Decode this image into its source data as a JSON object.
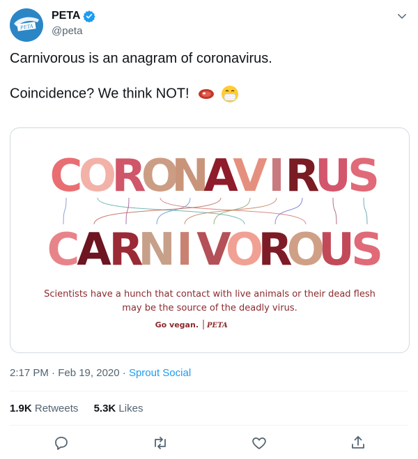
{
  "author": {
    "display_name": "PETA",
    "handle": "@peta",
    "avatar_text": "PETA"
  },
  "tweet": {
    "line1": "Carnivorous is an anagram of coronavirus.",
    "line2": "Coincidence? We think NOT!",
    "emojis": [
      "steak-emoji",
      "mask-face-emoji"
    ]
  },
  "image": {
    "word_top": [
      "C",
      "O",
      "R",
      "O",
      "N",
      "A",
      "V",
      "I",
      "R",
      "U",
      "S"
    ],
    "word_bottom": [
      "C",
      "A",
      "R",
      "N",
      "I",
      "V",
      "O",
      "R",
      "O",
      "U",
      "S"
    ],
    "caption_line1": "Scientists have a hunch that contact with live animals or their dead flesh",
    "caption_line2": "may be the source of the deadly virus.",
    "slogan": "Go vegan.",
    "logo": "PETA"
  },
  "meta": {
    "time": "2:17 PM · Feb 19, 2020 · ",
    "source": "Sprout Social"
  },
  "stats": {
    "retweets_count": "1.9K",
    "retweets_label": "Retweets",
    "likes_count": "5.3K",
    "likes_label": "Likes"
  },
  "colors": {
    "link": "#1d9bf0",
    "verified": "#1d9bf0",
    "avatar_bg": "#2b86c6"
  }
}
